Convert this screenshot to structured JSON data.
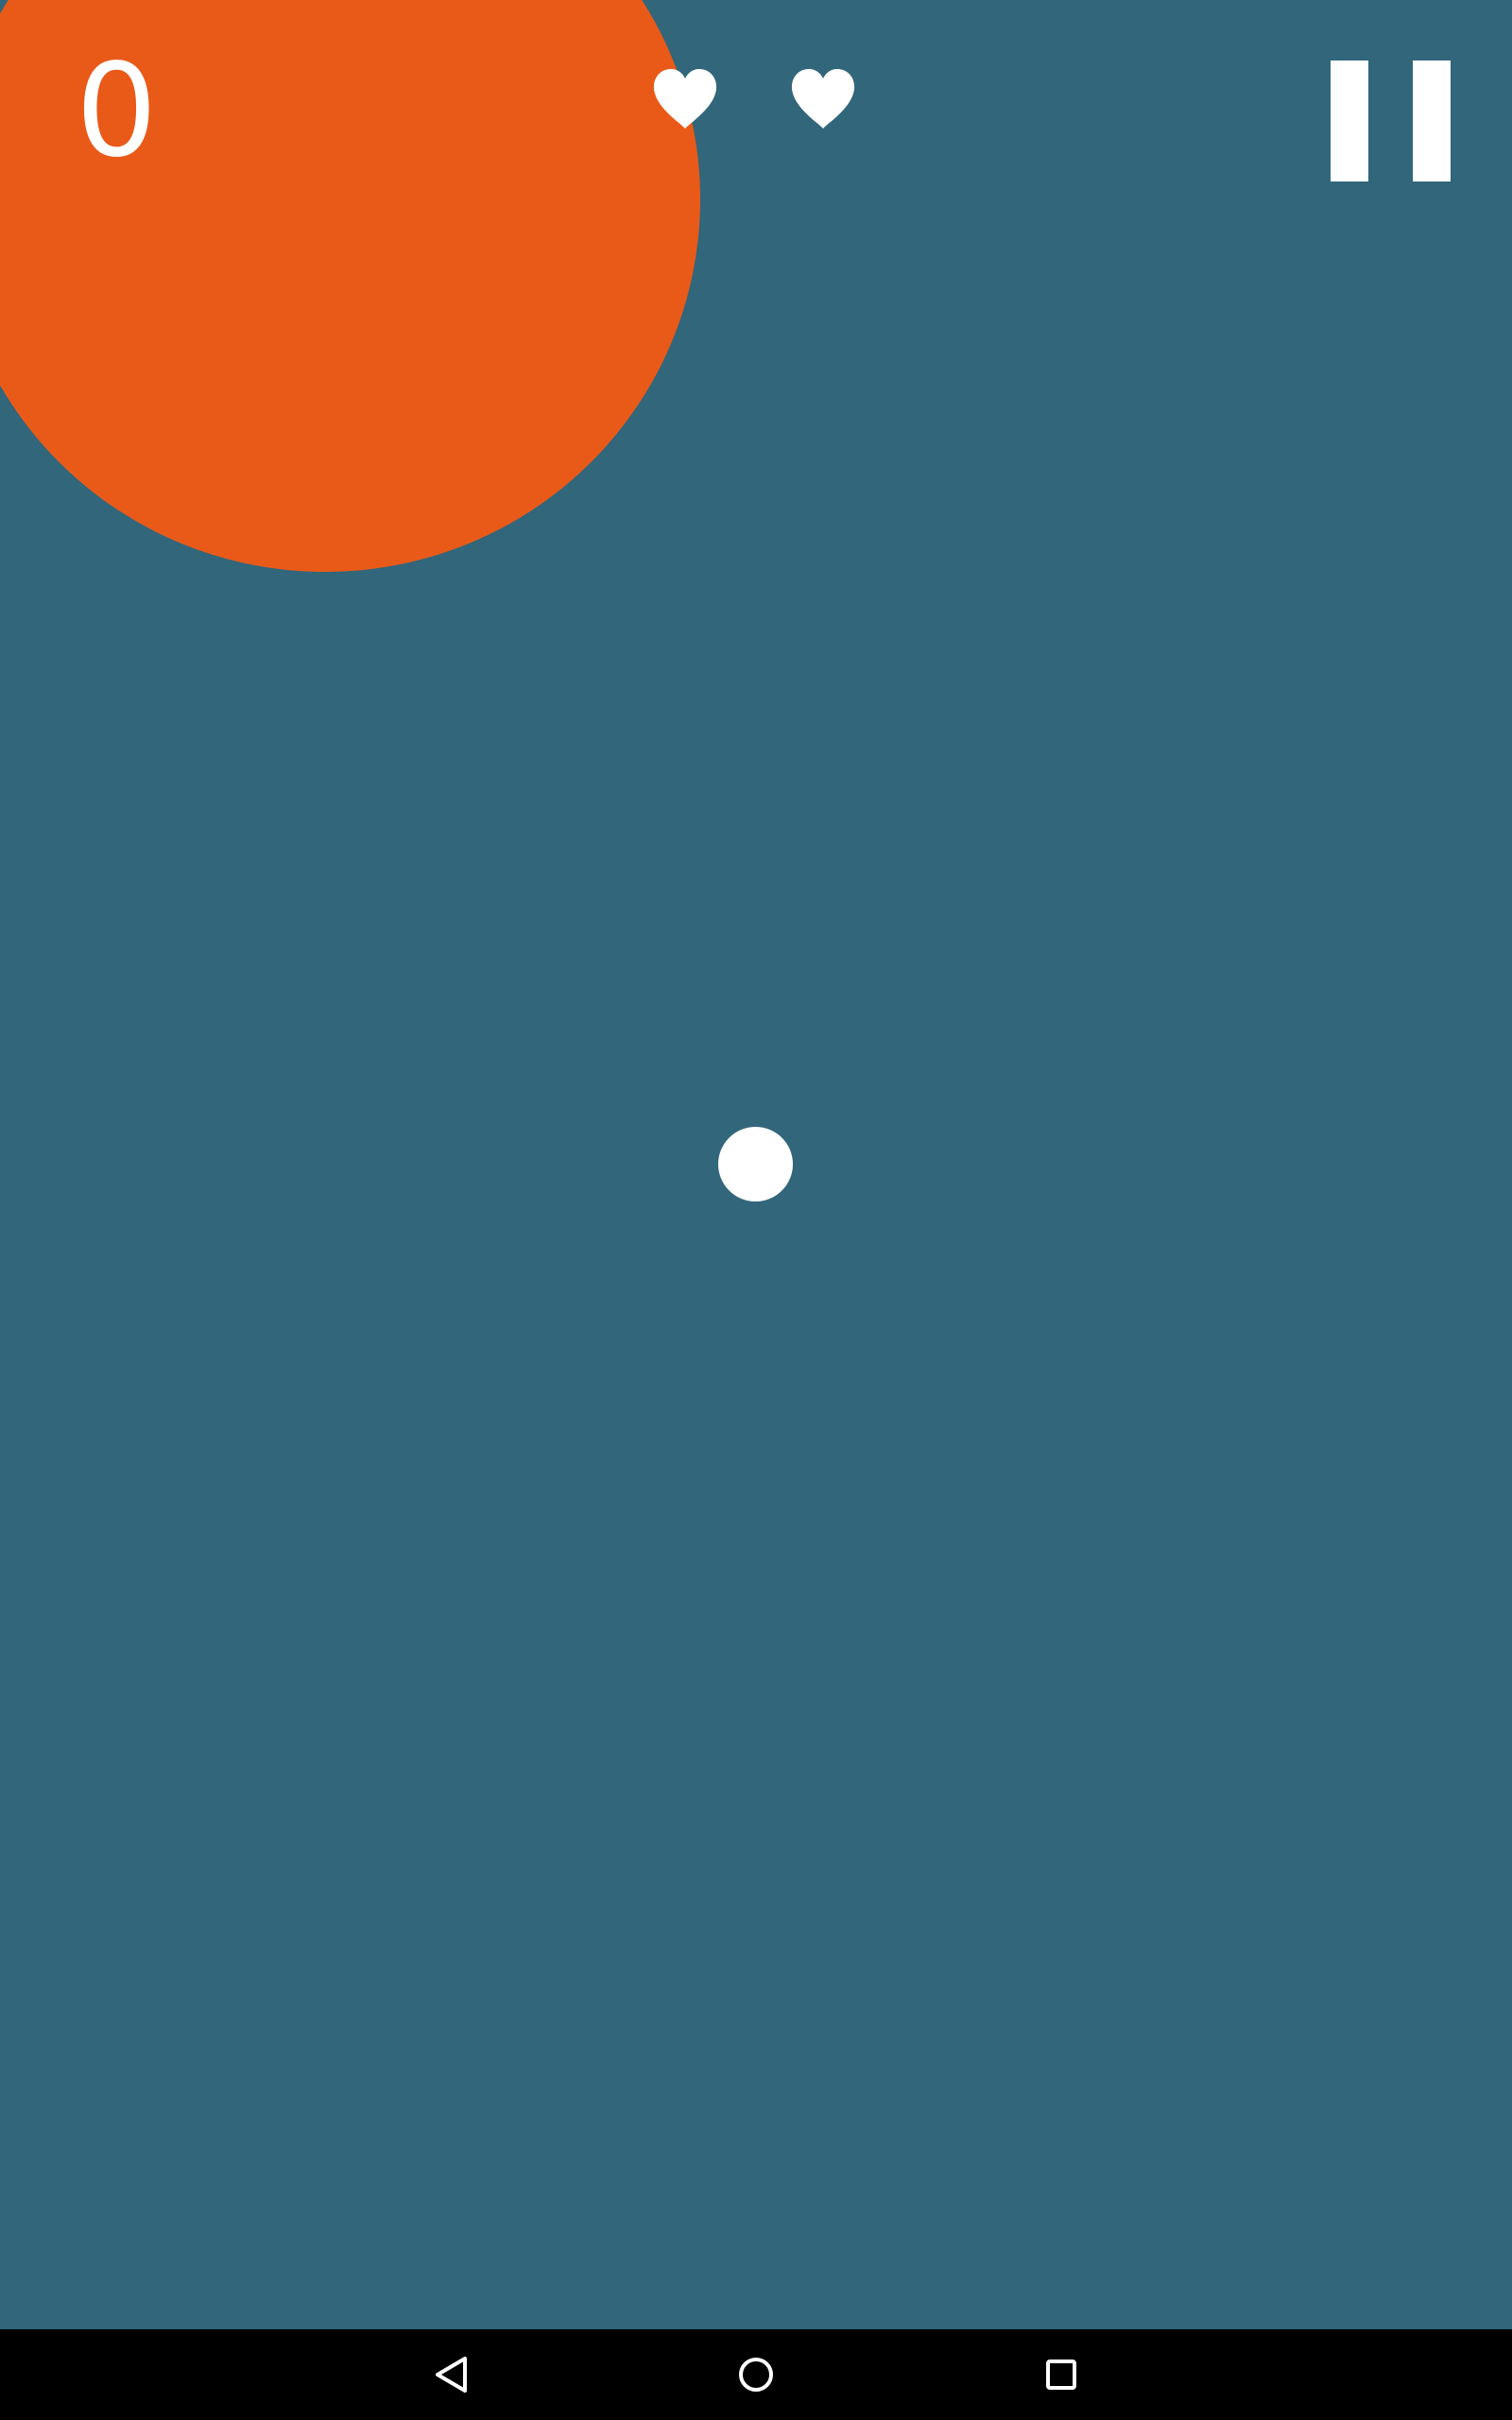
{
  "hud": {
    "score": "0",
    "lives": 2,
    "lives_icon": "heart-icon",
    "pause_icon": "pause-icon"
  },
  "game": {
    "enemy_color": "#e95a19",
    "player_color": "#ffffff",
    "background_color": "#31667b"
  },
  "nav_bar": {
    "back_icon": "back-triangle-icon",
    "home_icon": "home-circle-icon",
    "recents_icon": "recents-square-icon"
  }
}
